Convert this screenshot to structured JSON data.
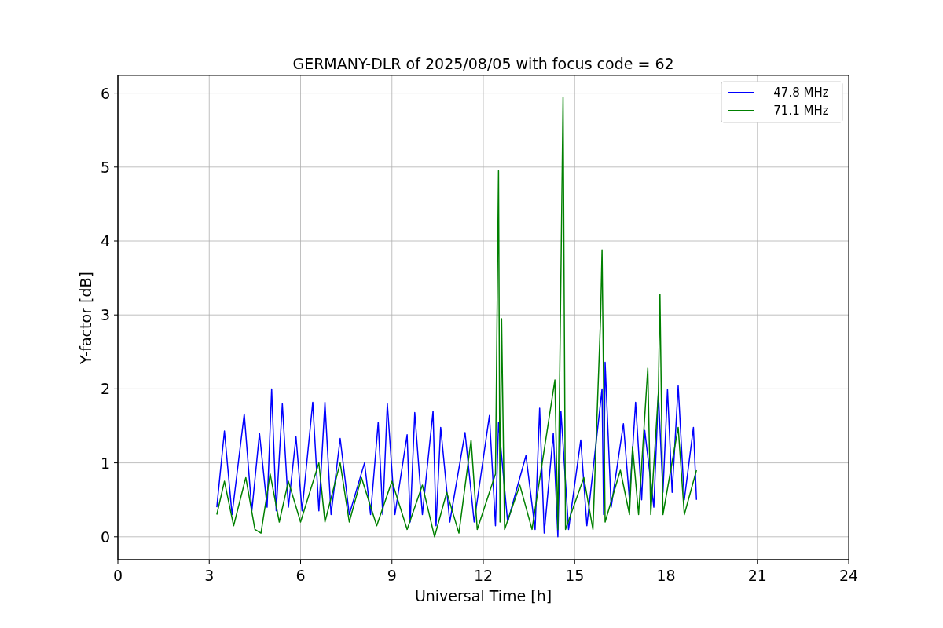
{
  "chart_data": {
    "type": "line",
    "title": "GERMANY-DLR of 2025/08/05 with focus code = 62",
    "xlabel": "Universal Time [h]",
    "ylabel": "Y-factor [dB]",
    "xlim": [
      0,
      24
    ],
    "ylim": [
      -0.31,
      6.24
    ],
    "xticks": [
      0,
      3,
      6,
      9,
      12,
      15,
      18,
      21,
      24
    ],
    "yticks": [
      0,
      1,
      2,
      3,
      4,
      5,
      6
    ],
    "grid": true,
    "legend": true,
    "series": [
      {
        "name": "   47.8 MHz",
        "color": "#0000ff",
        "x": [
          3.25,
          3.5,
          3.75,
          4.15,
          4.4,
          4.65,
          4.9,
          5.05,
          5.2,
          5.4,
          5.6,
          5.85,
          6.05,
          6.4,
          6.6,
          6.8,
          7.0,
          7.3,
          7.6,
          8.1,
          8.3,
          8.55,
          8.7,
          8.85,
          9.1,
          9.5,
          9.6,
          9.75,
          10.0,
          10.35,
          10.45,
          10.6,
          10.9,
          11.4,
          11.7,
          12.2,
          12.4,
          12.5,
          12.8,
          13.4,
          13.7,
          13.85,
          14.0,
          14.3,
          14.45,
          14.55,
          14.8,
          15.2,
          15.4,
          15.9,
          15.95,
          16.0,
          16.2,
          16.6,
          16.8,
          17.0,
          17.2,
          17.3,
          17.6,
          17.75,
          17.9,
          18.05,
          18.2,
          18.4,
          18.6,
          18.9,
          19.0
        ],
        "values": [
          0.4,
          1.43,
          0.3,
          1.66,
          0.35,
          1.4,
          0.4,
          2.0,
          0.35,
          1.8,
          0.4,
          1.35,
          0.35,
          1.82,
          0.35,
          1.82,
          0.3,
          1.33,
          0.3,
          1.0,
          0.3,
          1.55,
          0.3,
          1.8,
          0.3,
          1.38,
          0.2,
          1.68,
          0.3,
          1.7,
          0.15,
          1.48,
          0.2,
          1.41,
          0.2,
          1.64,
          0.15,
          1.55,
          0.2,
          1.1,
          0.1,
          1.74,
          0.05,
          1.4,
          0.0,
          1.7,
          0.1,
          1.31,
          0.15,
          2.0,
          0.3,
          2.36,
          0.4,
          1.53,
          0.5,
          1.82,
          0.5,
          1.44,
          0.4,
          1.94,
          0.6,
          1.99,
          0.6,
          2.04,
          0.5,
          1.48,
          0.5
        ]
      },
      {
        "name": "   71.1 MHz",
        "color": "#008000",
        "x": [
          3.25,
          3.5,
          3.8,
          4.2,
          4.5,
          4.7,
          5.0,
          5.3,
          5.6,
          6.0,
          6.6,
          6.8,
          7.3,
          7.6,
          8.0,
          8.5,
          9.0,
          9.5,
          10.0,
          10.4,
          10.8,
          11.2,
          11.6,
          11.8,
          12.4,
          12.5,
          12.55,
          12.6,
          12.7,
          13.2,
          13.6,
          14.35,
          14.45,
          14.62,
          14.7,
          15.3,
          15.6,
          15.85,
          15.9,
          16.0,
          16.5,
          16.8,
          16.9,
          17.1,
          17.4,
          17.5,
          17.75,
          17.8,
          17.9,
          18.4,
          18.6,
          19.0
        ],
        "values": [
          0.3,
          0.75,
          0.15,
          0.8,
          0.1,
          0.05,
          0.85,
          0.2,
          0.75,
          0.2,
          1.0,
          0.2,
          1.0,
          0.2,
          0.8,
          0.15,
          0.75,
          0.1,
          0.7,
          0.0,
          0.6,
          0.05,
          1.31,
          0.1,
          0.85,
          4.95,
          0.2,
          2.95,
          0.1,
          0.7,
          0.1,
          2.12,
          0.1,
          5.95,
          0.1,
          0.8,
          0.1,
          2.95,
          3.88,
          0.2,
          0.9,
          0.3,
          1.22,
          0.3,
          2.28,
          0.3,
          1.95,
          3.28,
          0.3,
          1.48,
          0.3,
          0.9
        ]
      }
    ]
  }
}
